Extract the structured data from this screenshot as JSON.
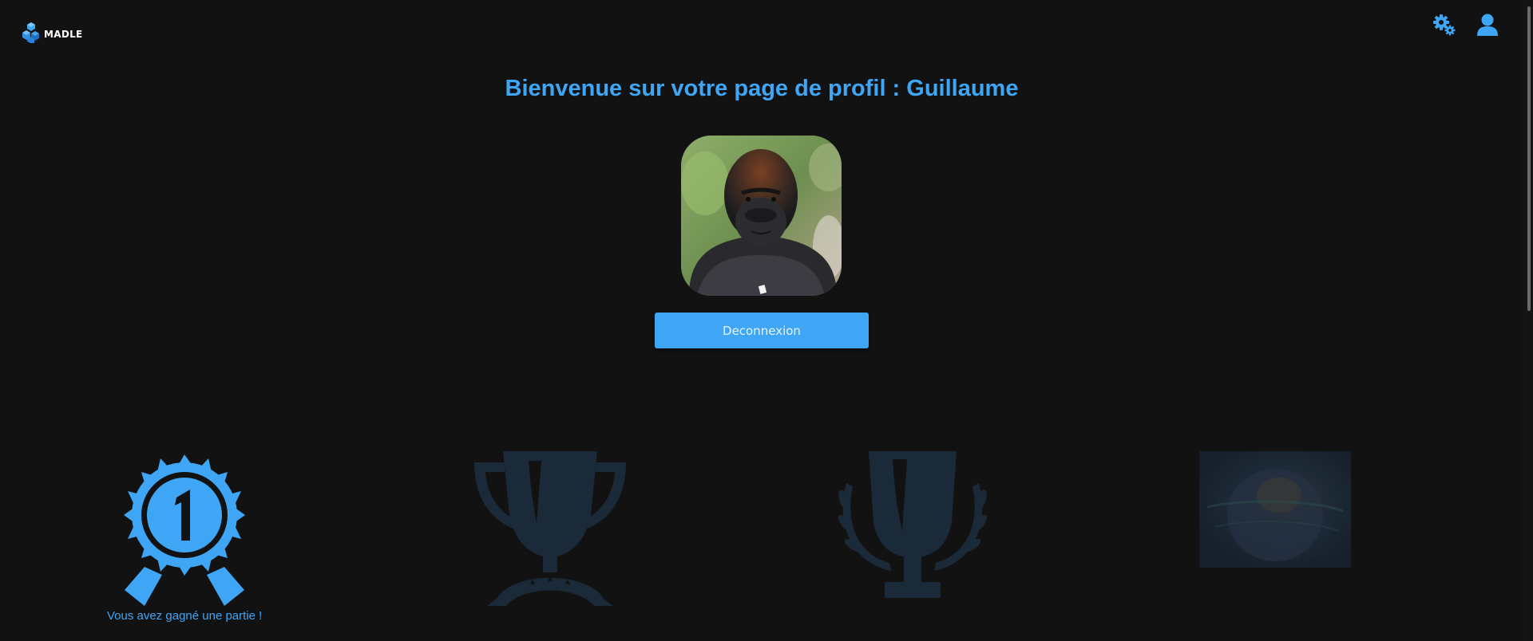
{
  "app": {
    "name": "MADLE"
  },
  "header": {
    "settings_icon": "gears-icon",
    "profile_icon": "user-icon"
  },
  "profile": {
    "title": "Bienvenue sur votre page de profil : Guillaume",
    "avatar_icon": "gorilla-avatar",
    "logout_label": "Deconnexion"
  },
  "achievements": [
    {
      "icon": "first-place-ribbon-icon",
      "label": "Vous avez gagné une partie !",
      "unlocked": true
    },
    {
      "icon": "trophy-stars-icon",
      "label": "",
      "unlocked": false
    },
    {
      "icon": "trophy-laurel-icon",
      "label": "",
      "unlocked": false
    },
    {
      "icon": "cosmic-brain-image",
      "label": "",
      "unlocked": false
    }
  ],
  "colors": {
    "background": "#121213",
    "accent": "#3ea6f5",
    "locked": "#1b2a38"
  }
}
